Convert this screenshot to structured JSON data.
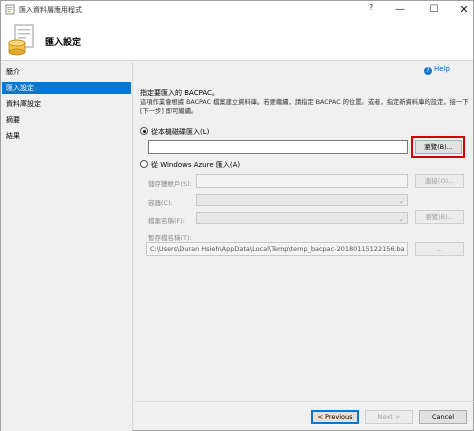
{
  "window": {
    "title": "匯入資料層應用程式",
    "help_mark": "?",
    "minimize": "—",
    "maximize": "☐",
    "close": "✕"
  },
  "header": {
    "title": "匯入設定"
  },
  "sidebar": {
    "items": [
      {
        "label": "簡介"
      },
      {
        "label": "匯入設定"
      },
      {
        "label": "資料庫設定"
      },
      {
        "label": "摘要"
      },
      {
        "label": "結果"
      }
    ],
    "active_index": 1
  },
  "main": {
    "help_label": "Help",
    "subtitle": "指定要匯入的 BACPAC。",
    "description": "這項作業會根據 BACPAC 檔案建立資料庫。若要繼續，請指定 BACPAC 的位置。或者，指定新資料庫的設定，接一下 [下一步] 即可繼續。",
    "local_option": {
      "label": "從本機磁碟匯入(L)",
      "checked": true,
      "path_value": "",
      "browse_label": "瀏覽(B)..."
    },
    "azure_option": {
      "label": "從 Windows Azure 匯入(A)",
      "checked": false,
      "storage_account_label": "儲存體帳戶(S):",
      "connect_label": "連接(O)...",
      "container_label": "容器(C):",
      "file_name_label": "檔案名稱(F):",
      "browse_label": "瀏覽(B)...",
      "temp_file_label": "暫存檔名稱(T):",
      "temp_file_value": "C:\\Users\\Duran Hsieh\\AppData\\Local\\Temp\\temp_bacpac-20180115122156.ba",
      "temp_browse_label": "..."
    }
  },
  "footer": {
    "previous_label": "< Previous",
    "next_label": "Next >",
    "cancel_label": "Cancel"
  },
  "colors": {
    "accent": "#0078d7",
    "highlight": "#d40000"
  }
}
